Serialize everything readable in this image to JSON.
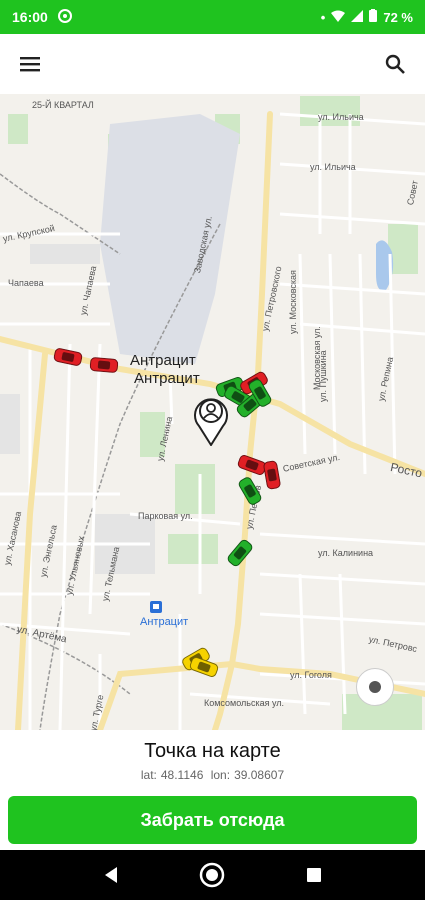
{
  "status": {
    "time": "16:00",
    "battery": "72 %"
  },
  "colors": {
    "brand_green": "#1fc31f",
    "car_red": "#e01f24",
    "car_green": "#23b02a",
    "car_yellow": "#f5d200"
  },
  "map": {
    "labels": {
      "kvartal": "25-Й КВАРТАЛ",
      "ilyicha_1": "ул. Ильича",
      "ilyicha_2": "ул. Ильича",
      "sovetskaya_right": "Совет",
      "krupskoy": "ул. Крупской",
      "chapaeva_1": "Чапаева",
      "chapaeva_2": "ул. Чапаева",
      "zavodskaya": "Заводская ул.",
      "petrovskogo_1": "ул. Петровского",
      "moskovskaya": "ул. Московская",
      "moskovskaya_2": "Московская ул.",
      "pushkina": "ул. Пушкина",
      "repina": "ул. Репина",
      "city_1": "Антрацит",
      "city_2": "Антрацит",
      "lenina": "ул. Ленина",
      "sovetskaya": "Советская ул.",
      "rostov": "Росто",
      "parkovaya": "Парковая ул.",
      "petrovskogo_2": "ул. Петров",
      "kalinina": "ул. Калинина",
      "khasanova": "ул. Хасанова",
      "engelsa": "ул. Энгельса",
      "ulyanovykh": "ул. Ульяновых",
      "telmana": "ул. Тельмана",
      "station": "Антрацит",
      "artema": "ул. Артёма",
      "petrovskogo_3": "ул. Петровс",
      "gogolya": "ул. Гоголя",
      "komsomolskaya": "Комсомольская ул.",
      "turgeneva": "ул. Турге"
    }
  },
  "panel": {
    "title": "Точка на карте",
    "lat_label": "lat:",
    "lat": "48.1146",
    "lon_label": "lon:",
    "lon": "39.08607",
    "button": "Забрать отсюда"
  }
}
